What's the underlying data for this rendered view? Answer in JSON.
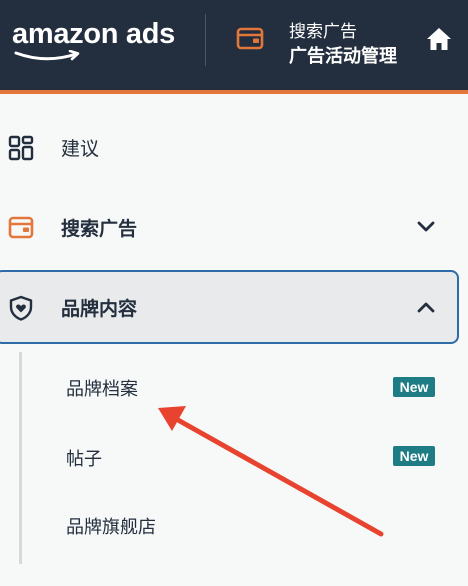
{
  "header": {
    "logo_text": "amazon ads",
    "breadcrumb_top": "搜索广告",
    "breadcrumb_bottom": "广告活动管理",
    "icons": [
      "wallet-icon",
      "home-icon"
    ],
    "background_color": "#232f3e",
    "accent_color": "#e3763a"
  },
  "nav": {
    "items": [
      {
        "label": "建议",
        "icon": "grid-icon"
      },
      {
        "label": "搜索广告",
        "icon": "wallet-icon",
        "expanded": false
      },
      {
        "label": "品牌内容",
        "icon": "shield-heart-icon",
        "expanded": true,
        "selected": true
      }
    ],
    "sub_items": [
      {
        "label": "品牌档案",
        "badge": "New"
      },
      {
        "label": "帖子",
        "badge": "New"
      },
      {
        "label": "品牌旗舰店"
      }
    ],
    "badge_color": "#1d7c84",
    "selected_border_color": "#2f6ba8"
  },
  "annotation": {
    "type": "red-arrow",
    "color": "#e8432e",
    "points_to": "品牌档案"
  }
}
